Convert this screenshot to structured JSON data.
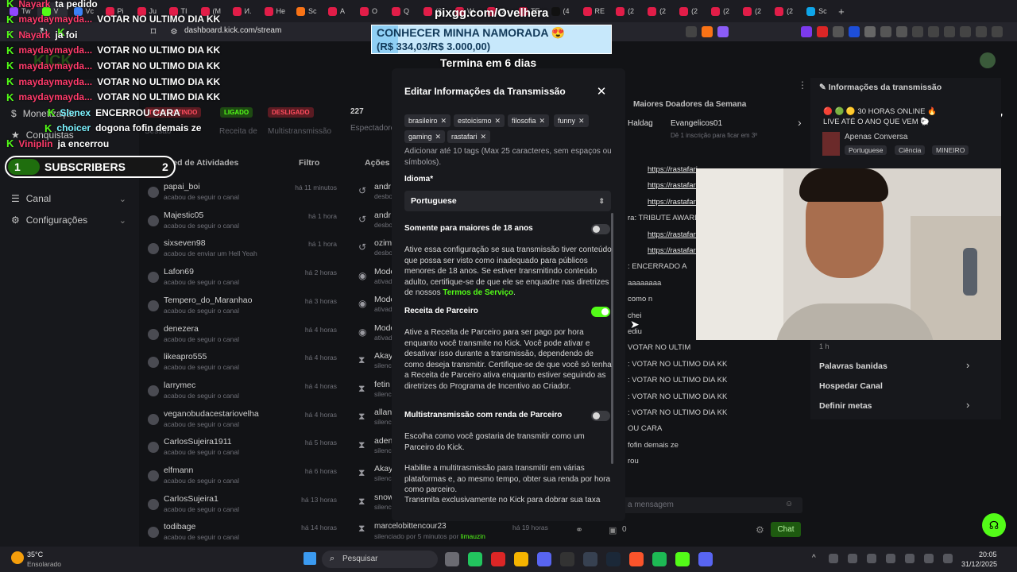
{
  "browser": {
    "tabs": [
      {
        "label": "Tw",
        "color": "#9146ff"
      },
      {
        "label": "V",
        "color": "#53fc18",
        "active": true
      },
      {
        "label": "Vc",
        "color": "#3b82f6"
      },
      {
        "label": "Pi",
        "color": "#e11d48"
      },
      {
        "label": "Ju",
        "color": "#e11d48"
      },
      {
        "label": "TI",
        "color": "#e11d48"
      },
      {
        "label": "(M",
        "color": "#e11d48"
      },
      {
        "label": "И.",
        "color": "#e11d48"
      },
      {
        "label": "He",
        "color": "#e11d48"
      },
      {
        "label": "Sc",
        "color": "#f97316"
      },
      {
        "label": "A",
        "color": "#e11d48"
      },
      {
        "label": "O",
        "color": "#e11d48"
      },
      {
        "label": "Q",
        "color": "#e11d48"
      },
      {
        "label": "(2",
        "color": "#e11d48"
      },
      {
        "label": "W",
        "color": "#e11d48"
      },
      {
        "label": "(2",
        "color": "#e11d48"
      },
      {
        "label": "TE",
        "color": "#e11d48"
      },
      {
        "label": "(4",
        "color": "#111111"
      },
      {
        "label": "RE",
        "color": "#e11d48"
      },
      {
        "label": "(2",
        "color": "#e11d48"
      },
      {
        "label": "(2",
        "color": "#e11d48"
      },
      {
        "label": "(2",
        "color": "#e11d48"
      },
      {
        "label": "(2",
        "color": "#e11d48"
      },
      {
        "label": "(2",
        "color": "#e11d48"
      },
      {
        "label": "(2",
        "color": "#e11d48"
      },
      {
        "label": "Sc",
        "color": "#0ea5e9"
      }
    ],
    "new_tab": "+",
    "url": "dashboard.kick.com/stream"
  },
  "overlay": {
    "watermark": "pixgg.com/Ovelhera",
    "goal_title": "CONHECER MINHA NAMORADA 😍",
    "goal_progress": "(R$ 334,03/R$ 3.000,00)",
    "goal_fraction": 0.111,
    "countdown": "Termina em 6 dias",
    "subs_left": "1",
    "subs_label": "SUBSCRIBERS",
    "subs_right": "2",
    "viewer_count": "227",
    "chat": [
      {
        "user": "Nayark",
        "msg": "ta pedido",
        "k": "K"
      },
      {
        "user": "maydaymayda...",
        "msg": "VOTAR NO ULTIMO DIA KK",
        "k": "K"
      },
      {
        "user": "Nayark",
        "msg": "ja foi",
        "k": "K"
      },
      {
        "user": "maydaymayda...",
        "msg": "VOTAR NO ULTIMO DIA KK",
        "k": "K"
      },
      {
        "user": "maydaymayda...",
        "msg": "VOTAR NO ULTIMO DIA KK",
        "k": "K"
      },
      {
        "user": "maydaymayda...",
        "msg": "VOTAR NO ULTIMO DIA KK",
        "k": "K"
      },
      {
        "user": "maydaymayda...",
        "msg": "VOTAR NO ULTIMO DIA KK",
        "k": "K"
      },
      {
        "user": "Slenex",
        "msg": "ENCERROU CARA",
        "k": "K"
      },
      {
        "user": "choicer",
        "msg": "dogona fofin demais ze",
        "k": "K"
      },
      {
        "user": "Viniplin",
        "msg": "ja encerrou",
        "k": "K"
      }
    ]
  },
  "dashboard": {
    "nav": [
      "Monetização",
      "Conquistas",
      "Canal",
      "Configurações"
    ],
    "status_badges": [
      "TRANSMITINDO",
      "LIGADO",
      "DESLIGADO"
    ],
    "stats": [
      "Sessão",
      "Receita de",
      "Multistransmissão"
    ],
    "spectators_count": "227",
    "spectators_label": "Espectadores",
    "feed_title": "Feed de Atividades",
    "filter_label": "Filtro",
    "actions_label": "Ações de",
    "activity": [
      {
        "name": "papai_boi",
        "sub": "acabou de seguir o canal",
        "time": "há 11 minutos"
      },
      {
        "name": "Majestic05",
        "sub": "acabou de seguir o canal",
        "time": "há 1 hora"
      },
      {
        "name": "sixseven98",
        "sub": "acabou de enviar um Hell Yeah",
        "time": "há 1 hora"
      },
      {
        "name": "Lafon69",
        "sub": "acabou de seguir o canal",
        "time": "há 2 horas"
      },
      {
        "name": "Tempero_do_Maranhao",
        "sub": "acabou de seguir o canal",
        "time": "há 3 horas"
      },
      {
        "name": "denezera",
        "sub": "acabou de seguir o canal",
        "time": "há 4 horas"
      },
      {
        "name": "likeapro555",
        "sub": "acabou de seguir o canal",
        "time": "há 4 horas"
      },
      {
        "name": "larrymec",
        "sub": "acabou de seguir o canal",
        "time": "há 4 horas"
      },
      {
        "name": "veganobudacestariovelha",
        "sub": "acabou de seguir o canal",
        "time": "há 4 horas"
      },
      {
        "name": "CarlosSujeira1911",
        "sub": "acabou de seguir o canal",
        "time": "há 5 horas"
      },
      {
        "name": "elfmann",
        "sub": "acabou de seguir o canal",
        "time": "há 6 horas"
      },
      {
        "name": "CarlosSujeira1",
        "sub": "acabou de seguir o canal",
        "time": "há 13 horas"
      },
      {
        "name": "todibage",
        "sub": "acabou de seguir o canal",
        "time": "há 14 horas"
      }
    ],
    "actions": [
      {
        "name": "andr",
        "sub": "desbo"
      },
      {
        "name": "andr",
        "sub": "desbo"
      },
      {
        "name": "ozim",
        "sub": "desbo"
      },
      {
        "name": "Mode",
        "sub": "ativad"
      },
      {
        "name": "Mode",
        "sub": "ativad"
      },
      {
        "name": "Mode",
        "sub": "ativad"
      },
      {
        "name": "Akay",
        "sub": "silenc"
      },
      {
        "name": "fetin",
        "sub": "silenc"
      },
      {
        "name": "allan_",
        "sub": "silenc"
      },
      {
        "name": "aden",
        "sub": "silenc"
      },
      {
        "name": "Akay",
        "sub": "silenc"
      },
      {
        "name": "snow",
        "sub": "silenc"
      }
    ],
    "last_action": {
      "name": "marcelobittencour23",
      "sub": "silenciado por 5 minutos por",
      "by": "limauzin",
      "time": "há 19 horas"
    }
  },
  "modal": {
    "title": "Editar Informações da Transmissão",
    "tags": [
      "brasileiro",
      "estoicismo",
      "filosofia",
      "funny",
      "gaming",
      "rastafari"
    ],
    "tags_help": "Adicionar até 10 tags (Max 25 caracteres, sem espaços ou símbolos).",
    "language_label": "Idioma*",
    "language_value": "Portuguese",
    "adult_label": "Somente para maiores de 18 anos",
    "adult_on": false,
    "adult_desc": "Ative essa configuração se sua transmissão tiver conteúdo que possa ser visto como inadequado para públicos menores de 18 anos. Se estiver transmitindo conteúdo adulto, certifique-se de que ele se enquadre nas diretrizes de nossos",
    "terms_link": "Termos de Serviço",
    "partner_label": "Receita de Parceiro",
    "partner_on": true,
    "partner_desc": "Ative a Receita de Parceiro para ser pago por hora enquanto você transmite no Kick. Você pode ativar e desativar isso durante a transmissão, dependendo de como deseja transmitir. Certifique-se de que você só tenha a Receita de Parceiro ativa enquanto estiver seguindo as diretrizes do Programa de Incentivo ao Criador.",
    "multi_label": "Multistransmissão com renda de Parceiro",
    "multi_on": false,
    "multi_desc": "Escolha como você gostaria de transmitir como um Parceiro do Kick.",
    "multi_desc2": "Habilite a multitrasmissão para transmitir em várias plataformas e, ao mesmo tempo, obter sua renda por hora como parceiro.",
    "multi_desc3": "Transmita exclusivamente no Kick para dobrar sua taxa"
  },
  "right": {
    "top_donors": "Maiores Doadores da Semana",
    "donor1": "Haldag",
    "donor2": "Evangelicos01",
    "donor_note": "Dê 1 inscrição para ficar em 3º",
    "stream_info_title": "Informações da transmissão",
    "stream_title": "🔴 🟢 🟡 30 HORAS ONLINE 🔥 LIVE ATÉ O ANO QUE VEM 🐑 META ABERTA",
    "category": "Apenas Conversa",
    "info_tags": [
      "Portuguese",
      "Ciência",
      "MINEIRO"
    ],
    "chat": [
      {
        "t": "link",
        "v": "https://rastafari..."
      },
      {
        "t": "link",
        "v": "https://rastafar..."
      },
      {
        "t": "link",
        "v": "https://rastafar..."
      },
      {
        "t": "text",
        "v": "ra: TRIBUTE AWARDS"
      },
      {
        "t": "link",
        "v": "https://rastafar..."
      },
      {
        "t": "link",
        "v": "https://rastafar..."
      },
      {
        "t": "text",
        "v": ": ENCERRADO A"
      },
      {
        "t": "text",
        "v": "aaaaaaaa"
      },
      {
        "t": "text",
        "v": "como n"
      },
      {
        "t": "text",
        "v": "chei"
      },
      {
        "t": "text",
        "v": "ediu"
      },
      {
        "t": "text",
        "v": "VOTAR NO ULTIM"
      },
      {
        "t": "text",
        "v": ": VOTAR NO ULTIMO DIA KK"
      },
      {
        "t": "text",
        "v": ": VOTAR NO ULTIMO DIA KK"
      },
      {
        "t": "text",
        "v": ": VOTAR NO ULTIMO DIA KK"
      },
      {
        "t": "text",
        "v": ": VOTAR NO ULTIMO DIA KK"
      },
      {
        "t": "text",
        "v": "OU CARA"
      },
      {
        "t": "text",
        "v": "fofin demais ze"
      },
      {
        "t": "text",
        "v": "rou"
      }
    ],
    "chat_placeholder": "a mensagem",
    "chat_button": "Chat",
    "chat_count": "0",
    "menu": [
      "Palavras banidas",
      "Hospedar Canal",
      "Definir metas"
    ],
    "duration": "1 h"
  },
  "taskbar": {
    "weather_temp": "35°C",
    "weather_desc": "Ensolarado",
    "search_placeholder": "Pesquisar",
    "time": "20:05",
    "date": "31/12/2025"
  }
}
